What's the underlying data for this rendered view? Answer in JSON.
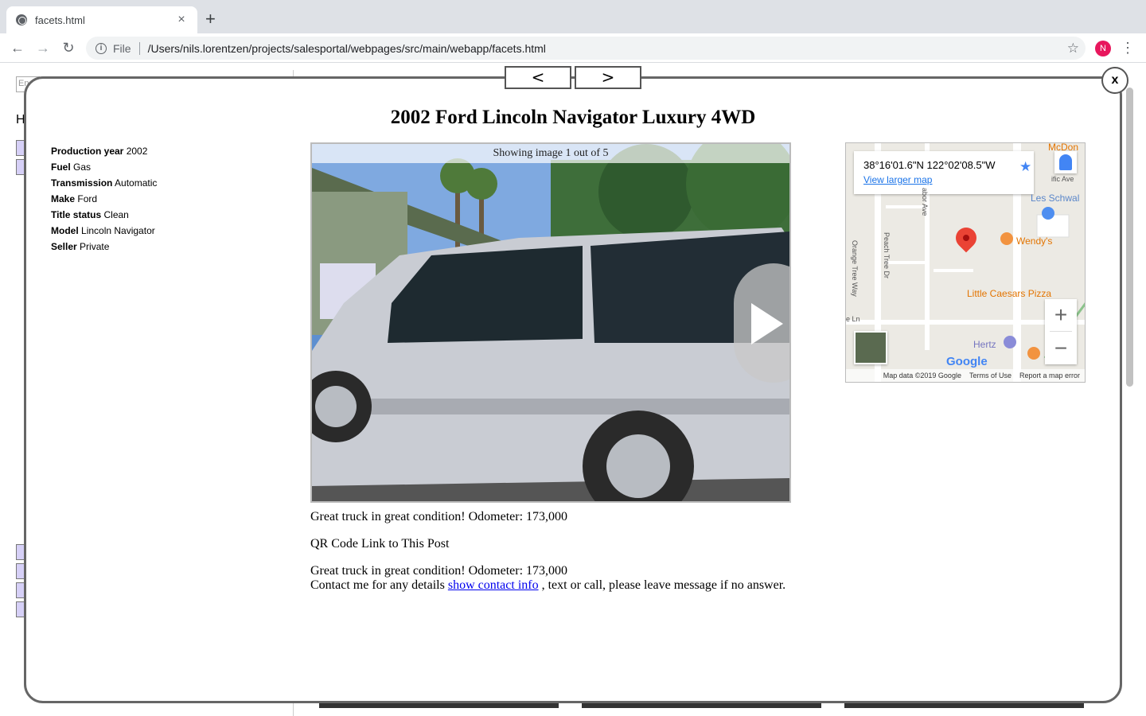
{
  "browser": {
    "tab_title": "facets.html",
    "tab_close": "×",
    "new_tab": "+",
    "back": "←",
    "forward": "→",
    "reload": "↻",
    "info": "i",
    "scheme": "File",
    "url": "/Users/nils.lorentzen/projects/salesportal/webpages/src/main/webapp/facets.html",
    "star": "☆",
    "profile_initial": "N",
    "menu": "⋮"
  },
  "background_page": {
    "input_placeholder": "En",
    "heading": "H"
  },
  "modal": {
    "prev_label": "<",
    "next_label": ">",
    "close_label": "x",
    "title": "2002 Ford Lincoln Navigator Luxury 4WD",
    "facets": [
      {
        "key": "Production year",
        "value": "2002"
      },
      {
        "key": "Fuel",
        "value": "Gas"
      },
      {
        "key": "Transmission",
        "value": "Automatic"
      },
      {
        "key": "Make",
        "value": "Ford"
      },
      {
        "key": "Title status",
        "value": "Clean"
      },
      {
        "key": "Model",
        "value": "Lincoln Navigator"
      },
      {
        "key": "Seller",
        "value": "Private"
      }
    ],
    "gallery": {
      "caption": "Showing image 1 out of 5",
      "current_index": 1,
      "total": 5
    },
    "summary": "Great truck in great condition! Odometer: 173,000",
    "qr_text": "QR Code Link to This Post",
    "body_line1": "Great truck in great condition! Odometer: 173,000",
    "body_line2_before": "Contact me for any details",
    "contact_link": "show contact info",
    "body_line2_after": ", text or call, please leave message if no answer."
  },
  "map": {
    "coords": "38°16'01.6\"N 122°02'08.5\"W",
    "larger_map_link": "View larger map",
    "star": "★",
    "labels": {
      "mcdonalds": "McDon",
      "les_schwab": "Les Schwal",
      "wendys": "Wendy's",
      "little_caesars": "Little Caesars Pizza",
      "hertz": "Hertz",
      "pacific_ave": "ific Ave",
      "arbor_ave": "abor Ave",
      "peach_tree": "Peach Tree Dr",
      "orange_tree": "Orange Tree Way",
      "ln": "e Ln"
    },
    "zoom_in": "+",
    "zoom_out": "−",
    "google": "Google",
    "footer": {
      "map_data": "Map data ©2019 Google",
      "terms": "Terms of Use",
      "report": "Report a map error"
    }
  }
}
